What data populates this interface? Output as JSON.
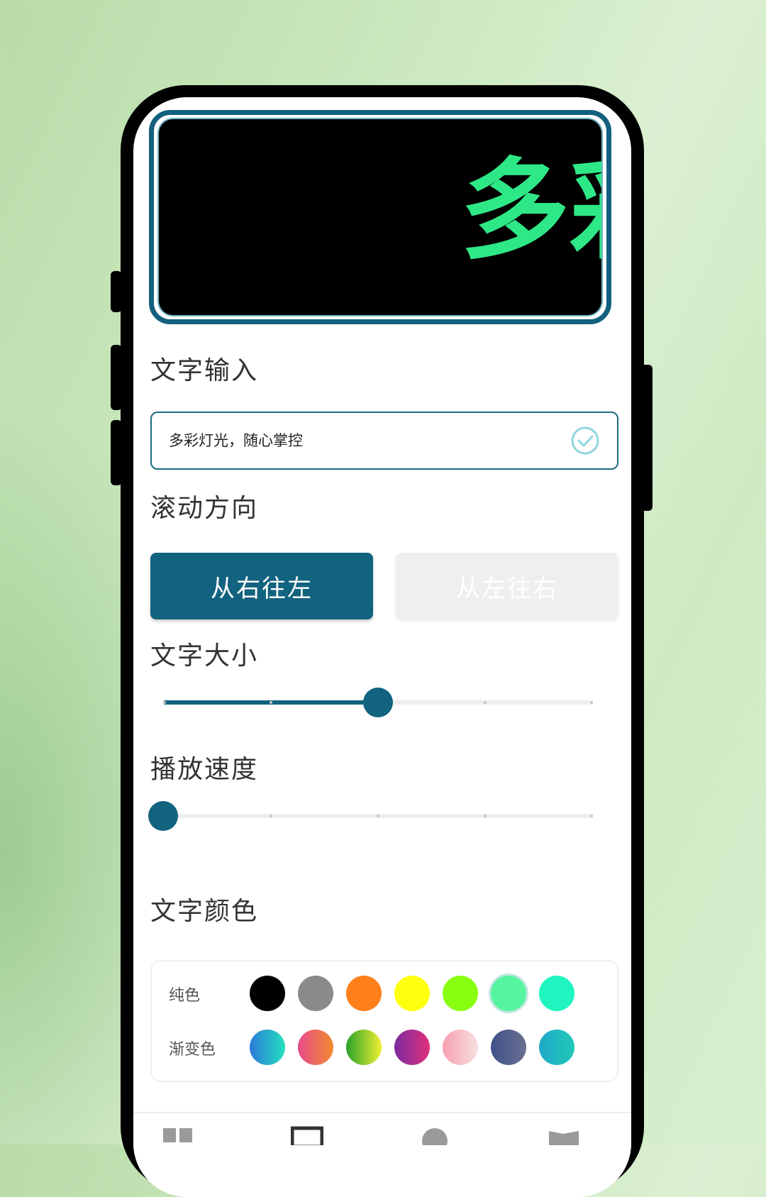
{
  "preview": {
    "text": "多彩"
  },
  "text_input": {
    "section_title": "文字输入",
    "value": "多彩灯光，随心掌控"
  },
  "scroll_direction": {
    "section_title": "滚动方向",
    "options": [
      "从右往左",
      "从左往右"
    ],
    "selected": "从右往左"
  },
  "text_size": {
    "section_title": "文字大小",
    "level": 0.5
  },
  "play_speed": {
    "section_title": "播放速度",
    "level": 0.0
  },
  "text_color": {
    "section_title": "文字颜色",
    "solid_label": "纯色",
    "gradient_label": "渐变色",
    "solid_colors": [
      "#000000",
      "#8a8a8a",
      "#ff7f1a",
      "#ffff10",
      "#88ff10",
      "#55f5a0",
      "#20f5c0"
    ],
    "gradients": [
      [
        "#2a7ad8",
        "#26e0c0"
      ],
      [
        "#e84a8a",
        "#f08a30"
      ],
      [
        "#2aa02a",
        "#f0f030"
      ],
      [
        "#7a2aa0",
        "#e0307a"
      ],
      [
        "#f5a0b0",
        "#f8e0e0"
      ],
      [
        "#40508a",
        "#6a7090"
      ],
      [
        "#20a8c8",
        "#20c8b8"
      ]
    ]
  },
  "colors": {
    "accent": "#12637f",
    "led_text": "#2ee887"
  },
  "bottom_nav": {
    "icons": [
      "grid-icon",
      "screen-icon",
      "compass-icon",
      "book-icon"
    ]
  }
}
